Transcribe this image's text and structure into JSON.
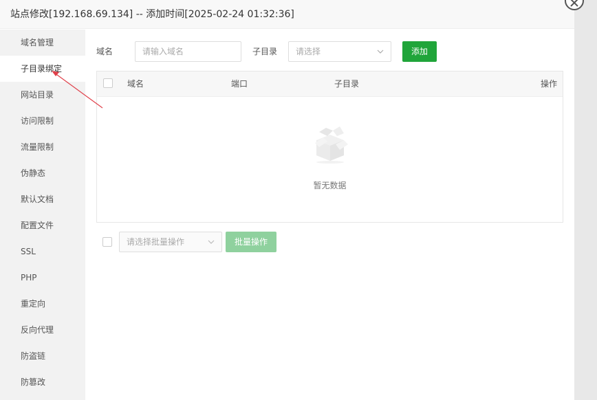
{
  "window": {
    "title": "站点修改[192.168.69.134] -- 添加时间[2025-02-24 01:32:36]"
  },
  "sidebar": {
    "items": [
      {
        "label": "域名管理"
      },
      {
        "label": "子目录绑定",
        "active": true
      },
      {
        "label": "网站目录"
      },
      {
        "label": "访问限制"
      },
      {
        "label": "流量限制"
      },
      {
        "label": "伪静态"
      },
      {
        "label": "默认文档"
      },
      {
        "label": "配置文件"
      },
      {
        "label": "SSL"
      },
      {
        "label": "PHP"
      },
      {
        "label": "重定向"
      },
      {
        "label": "反向代理"
      },
      {
        "label": "防盗链"
      },
      {
        "label": "防篡改"
      }
    ]
  },
  "form": {
    "domain_label": "域名",
    "domain_placeholder": "请输入域名",
    "subdir_label": "子目录",
    "subdir_placeholder": "请选择",
    "add_button": "添加"
  },
  "table": {
    "columns": [
      "域名",
      "端口",
      "子目录",
      "操作"
    ],
    "empty_text": "暂无数据"
  },
  "batch": {
    "select_placeholder": "请选择批量操作",
    "button": "批量操作"
  },
  "colors": {
    "accent": "#20a53a",
    "accent_disabled": "#8fd19e",
    "annotation_arrow": "#e0404a"
  }
}
